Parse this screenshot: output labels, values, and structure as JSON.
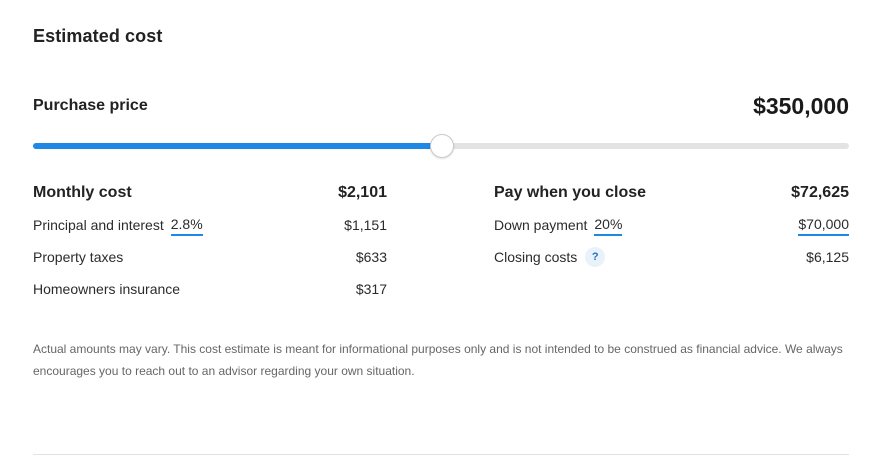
{
  "section_title": "Estimated cost",
  "purchase": {
    "label": "Purchase price",
    "value": "$350,000",
    "slider_fraction": 0.5
  },
  "monthly": {
    "title": "Monthly cost",
    "total": "$2,101",
    "principal_label": "Principal and interest",
    "principal_rate": "2.8%",
    "principal_value": "$1,151",
    "taxes_label": "Property taxes",
    "taxes_value": "$633",
    "insurance_label": "Homeowners insurance",
    "insurance_value": "$317"
  },
  "closing": {
    "title": "Pay when you close",
    "total": "$72,625",
    "down_label": "Down payment",
    "down_percent": "20%",
    "down_value": "$70,000",
    "closing_label": "Closing costs",
    "help_glyph": "?",
    "closing_value": "$6,125"
  },
  "disclaimer": "Actual amounts may vary. This cost estimate is meant for informational purposes only and is not intended to be construed as financial advice. We always encourages you to reach out to an advisor regarding your own situation.",
  "colors": {
    "accent": "#1e88e5",
    "track": "#e3e3e3"
  }
}
